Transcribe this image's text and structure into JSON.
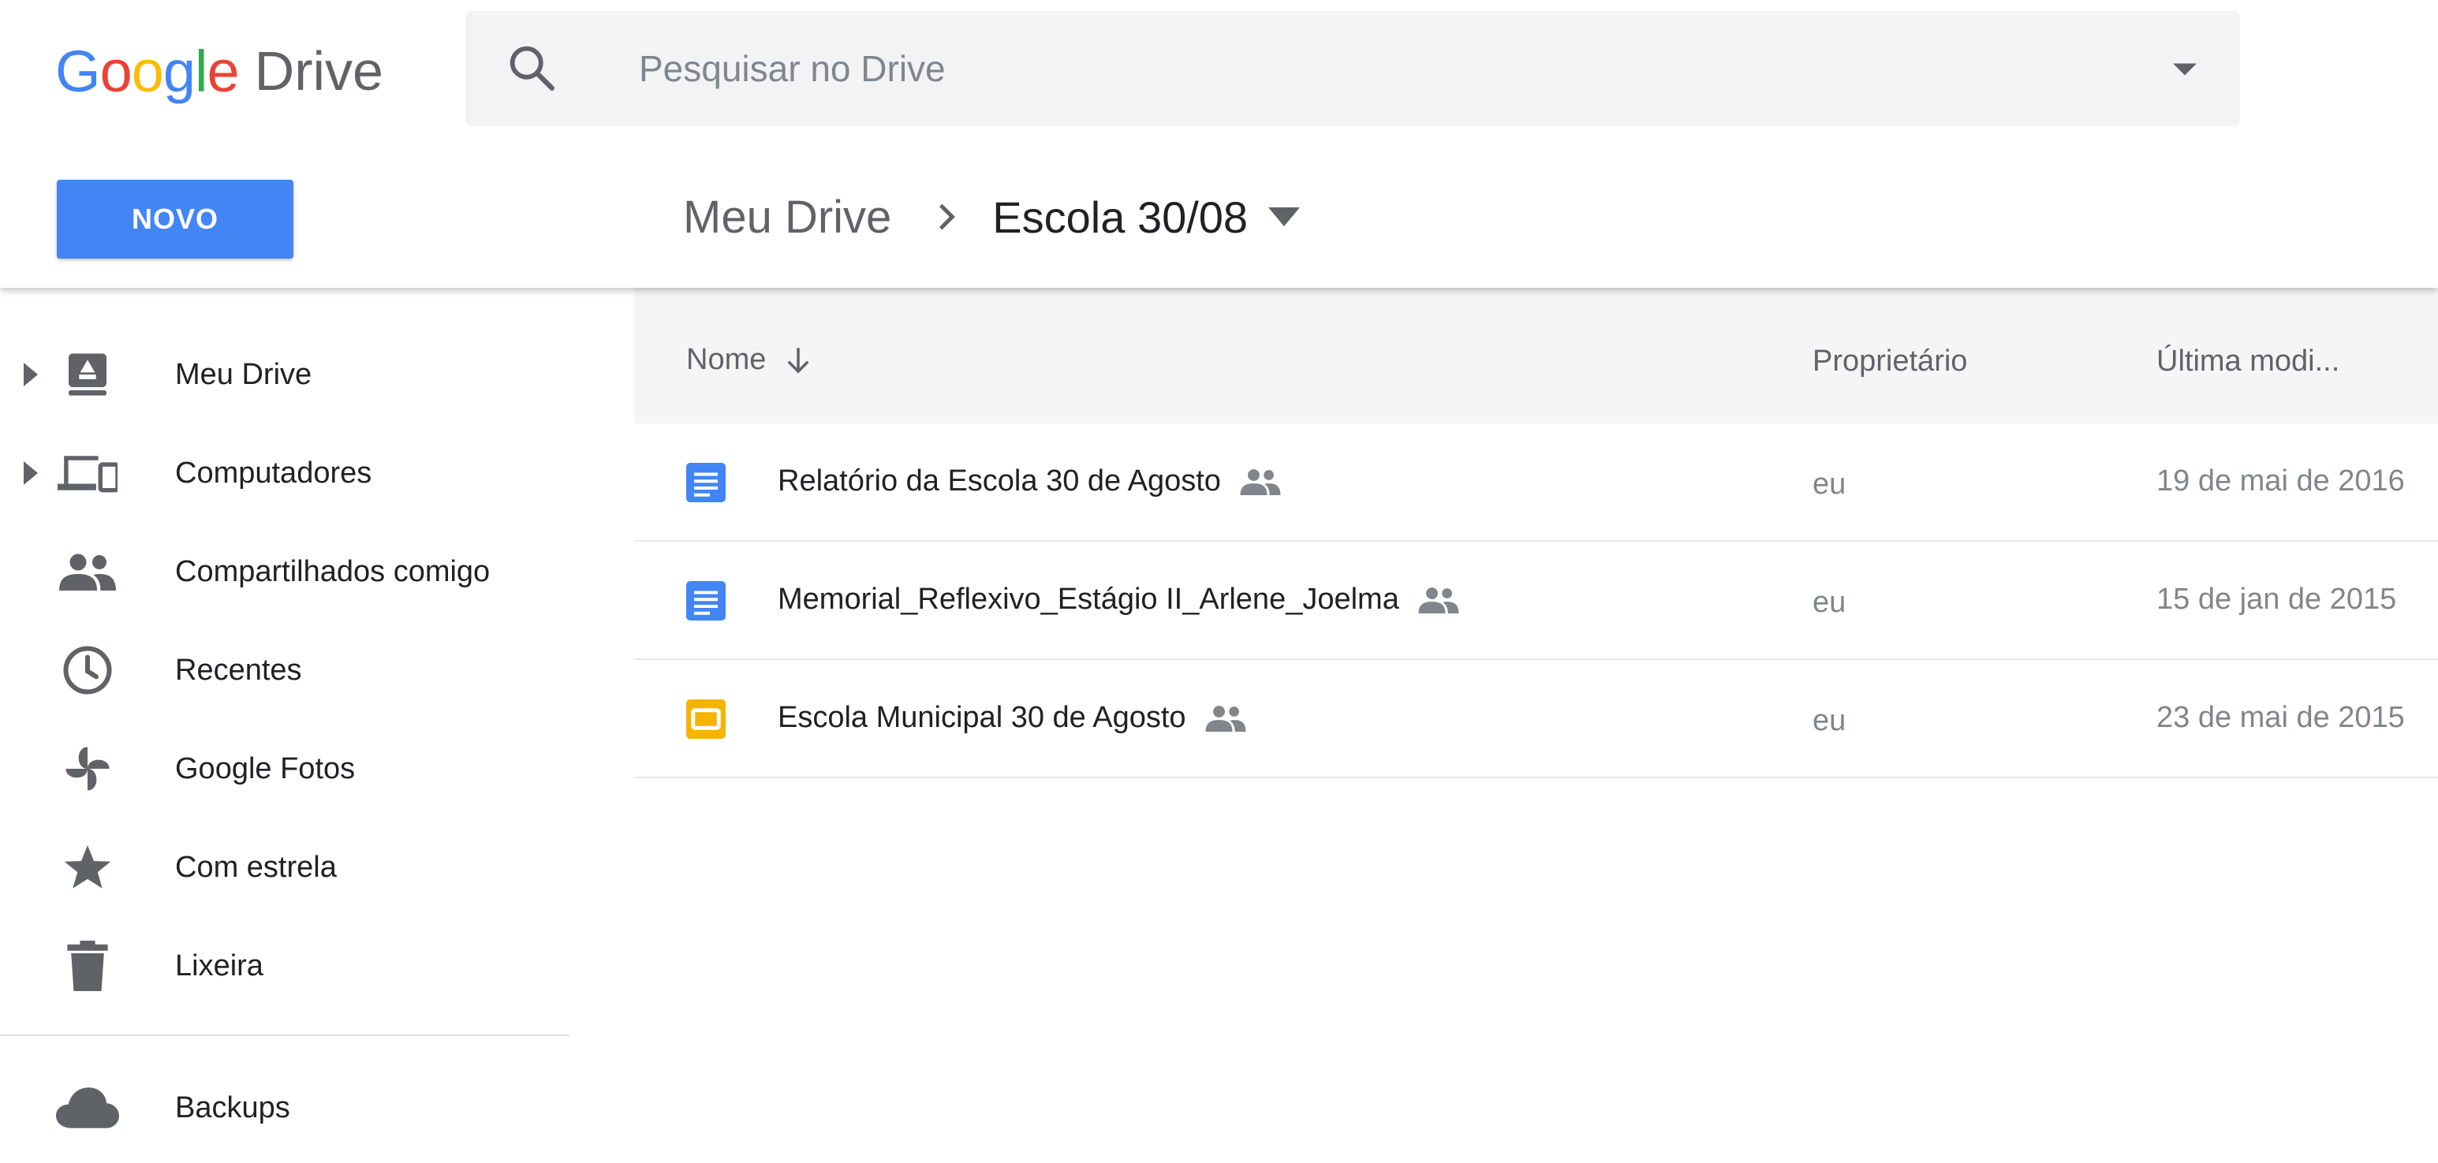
{
  "app": {
    "logo_letters": [
      {
        "char": "G",
        "color": "#4285f4"
      },
      {
        "char": "o",
        "color": "#ea4335"
      },
      {
        "char": "o",
        "color": "#fbbc05"
      },
      {
        "char": "g",
        "color": "#4285f4"
      },
      {
        "char": "l",
        "color": "#34a853"
      },
      {
        "char": "e",
        "color": "#ea4335"
      }
    ],
    "product_name": "Drive"
  },
  "search": {
    "placeholder": "Pesquisar no Drive",
    "value": "",
    "icon": "search-icon",
    "options_icon": "caret-down-icon"
  },
  "toolbar": {
    "new_label": "NOVO",
    "accent_color": "#4285f4"
  },
  "breadcrumb": {
    "root": "Meu Drive",
    "current": "Escola 30/08"
  },
  "sidebar": {
    "items": [
      {
        "label": "Meu Drive",
        "icon": "my-drive-icon",
        "expandable": true
      },
      {
        "label": "Computadores",
        "icon": "computers-icon",
        "expandable": true
      },
      {
        "label": "Compartilhados comigo",
        "icon": "shared-with-me-icon",
        "expandable": false
      },
      {
        "label": "Recentes",
        "icon": "clock-icon",
        "expandable": false
      },
      {
        "label": "Google Fotos",
        "icon": "photos-pinwheel-icon",
        "expandable": false
      },
      {
        "label": "Com estrela",
        "icon": "star-icon",
        "expandable": false
      },
      {
        "label": "Lixeira",
        "icon": "trash-icon",
        "expandable": false
      },
      {
        "label": "Backups",
        "icon": "cloud-icon",
        "expandable": false
      }
    ]
  },
  "list": {
    "columns": {
      "name": "Nome",
      "owner": "Proprietário",
      "modified": "Última modi..."
    },
    "sort": {
      "column": "name",
      "direction": "ascending",
      "icon": "arrow-down-icon"
    },
    "files": [
      {
        "name": "Relatório da Escola 30 de Agosto",
        "type": "document",
        "icon": "google-docs-icon",
        "shared": true,
        "owner": "eu",
        "modified": "19 de mai de 2016"
      },
      {
        "name": "Memorial_Reflexivo_Estágio II_Arlene_Joelma",
        "type": "document",
        "icon": "google-docs-icon",
        "shared": true,
        "owner": "eu",
        "modified": "15 de jan de 2015"
      },
      {
        "name": "Escola Municipal 30 de Agosto",
        "type": "presentation",
        "icon": "google-slides-icon",
        "shared": true,
        "owner": "eu",
        "modified": "23 de mai de 2015"
      }
    ]
  },
  "colors": {
    "docs_blue": "#4285f4",
    "slides_yellow": "#f4b400",
    "icon_gray": "#5f6368"
  }
}
